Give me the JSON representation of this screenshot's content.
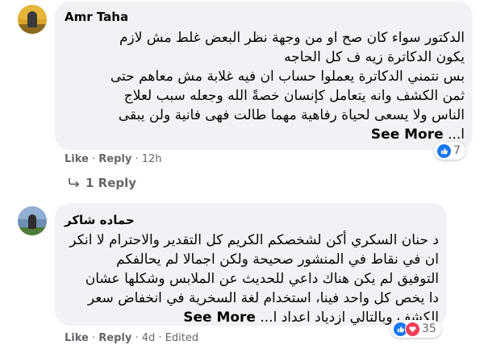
{
  "comments": [
    {
      "author": "Amr Taha",
      "lines": [
        "الدكتور سواء كان صح او من وجهة نظر البعض غلط مش لازم",
        "يكون الدكاترة زيه ف كل الحاجه",
        "بس نتمني الدكاترة يعملوا حساب ان فيه غلابة مش معاهم حتى",
        "ثمن الكشف وانه يتعامل كإنسان خصةً الله وجعله سبب لعلاج",
        "الناس ولا يسعى لحياة رفاهية مهما طالت فهى فانية ولن يبقى"
      ],
      "last_prefix": "ا...",
      "see_more": "See More",
      "like": "Like",
      "reply": "Reply",
      "time": "12h",
      "reaction_count": "7",
      "replies_label": "1 Reply"
    },
    {
      "author": "حماده شاكر",
      "lines": [
        "د حنان السكري أكن لشخصكم الكريم كل التقدير والاحترام لا انكر",
        "ان في نقاط في المنشور صحيحة ولكن اجمالا لم يحالفكم",
        "التوفيق لم يكن هناك داعي للحديث عن الملابس وشكلها عشان",
        "دا يخص كل واحد فينا، استخدام لغة السخرية في انخفاض سعر"
      ],
      "last_line": "الكشف وبالتالي ازدياد اعداد ا...",
      "see_more": "See More",
      "like": "Like",
      "reply": "Reply",
      "time": "4d",
      "edited": "Edited",
      "reaction_count": "35"
    }
  ],
  "colors": {
    "bubble": "#f0f2f5",
    "text": "#050505",
    "meta": "#65676b",
    "like_blue": "#1877f2",
    "love_red": "#f33e58"
  }
}
